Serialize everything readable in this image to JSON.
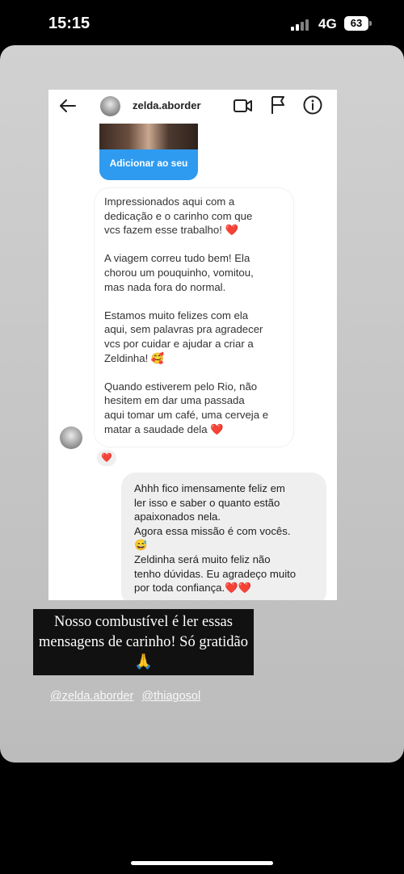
{
  "status_bar": {
    "time": "15:15",
    "network": "4G",
    "battery": "63"
  },
  "dm": {
    "username": "zelda.aborder",
    "story_button": "Adicionar ao seu story",
    "received_message": "Impressionados aqui com a\ndedicação e o carinho com que\nvcs fazem esse trabalho! ❤️\n\nA viagem correu tudo bem! Ela\nchorou um pouquinho, vomitou,\nmas nada fora do normal.\n\nEstamos muito felizes com ela\naqui, sem palavras pra agradecer\nvcs por cuidar e ajudar a criar a\nZeldinha! 🥰\n\nQuando estiverem pelo Rio, não\nhesitem em dar uma passada\naqui tomar um café, uma cerveja e\nmatar a saudade dela ❤️",
    "reaction": "❤️",
    "sent_message": "Ahhh fico imensamente feliz em\nler isso e saber o quanto estão\napaixonados nela.\nAgora essa missão é com vocês.\n😅\nZeldinha será muito feliz não\ntenho dúvidas. Eu agradeço muito\npor toda confiança.❤️❤️"
  },
  "story": {
    "caption": "Nosso combustível é ler essas mensagens de carinho! Só gratidão🙏",
    "mentions": [
      "@zelda.aborder",
      "@thiagosol"
    ]
  },
  "colors": {
    "accent": "#2e9bf0",
    "heart": "#d2232a",
    "caption_bg": "#111111"
  }
}
